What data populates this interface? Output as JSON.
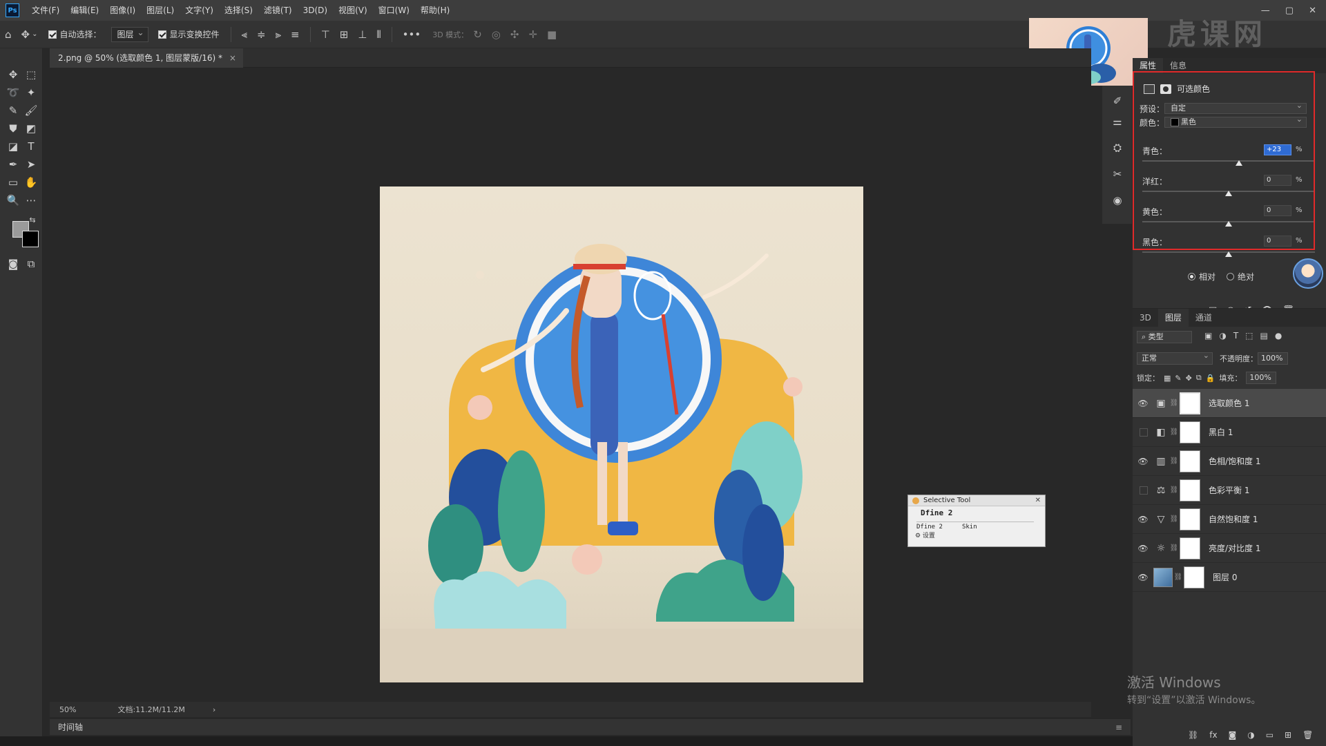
{
  "app": {
    "logo": "Ps"
  },
  "menu": [
    "文件(F)",
    "编辑(E)",
    "图像(I)",
    "图层(L)",
    "文字(Y)",
    "选择(S)",
    "滤镜(T)",
    "3D(D)",
    "视图(V)",
    "窗口(W)",
    "帮助(H)"
  ],
  "window_controls": {
    "minimize": "—",
    "restore": "▢",
    "close": "✕"
  },
  "options": {
    "auto_select_label": "自动选择：",
    "auto_select_target": "图层",
    "show_transform_label": "显示变换控件",
    "more": "•••",
    "mode_3d_label": "3D 模式："
  },
  "watermark": "虎课网",
  "document": {
    "tab_title": "2.png @ 50% (选取颜色 1, 图层蒙版/16) *",
    "tab_close": "×",
    "zoom": "50%",
    "doc_size": "文档:11.2M/11.2M",
    "arrow": "›"
  },
  "timeline_label": "时间轴",
  "filter_panel": {
    "title": "Selective Tool",
    "close": "✕",
    "name": "Dfine 2",
    "subs": [
      "Dfine 2",
      "Skin"
    ],
    "settings": "⚙ 设置"
  },
  "properties": {
    "tabs": [
      "属性",
      "信息"
    ],
    "title": "可选颜色",
    "preset_label": "预设：",
    "preset_value": "自定",
    "colors_label": "颜色：",
    "colors_value": "黑色",
    "sliders": [
      {
        "label": "青色：",
        "value": "+23",
        "pct": "%",
        "position": 0.56
      },
      {
        "label": "洋红：",
        "value": "0",
        "pct": "%",
        "position": 0.5
      },
      {
        "label": "黄色：",
        "value": "0",
        "pct": "%",
        "position": 0.5
      },
      {
        "label": "黑色：",
        "value": "0",
        "pct": "%",
        "position": 0.5
      }
    ],
    "method_relative": "相对",
    "method_absolute": "绝对"
  },
  "layers": {
    "tabs": [
      "3D",
      "图层",
      "通道"
    ],
    "filter_label": "类型",
    "blend_mode": "正常",
    "opacity_label": "不透明度：",
    "opacity_value": "100%",
    "lock_label": "锁定：",
    "fill_label": "填充：",
    "fill_value": "100%",
    "items": [
      {
        "name": "选取颜色 1",
        "icon": "selective-color-icon",
        "visible": true,
        "selected": true
      },
      {
        "name": "黑白 1",
        "icon": "black-white-icon",
        "visible": false,
        "selected": false
      },
      {
        "name": "色相/饱和度 1",
        "icon": "hue-saturation-icon",
        "visible": true,
        "selected": false
      },
      {
        "name": "色彩平衡 1",
        "icon": "color-balance-icon",
        "visible": false,
        "selected": false
      },
      {
        "name": "自然饱和度 1",
        "icon": "vibrance-icon",
        "visible": true,
        "selected": false
      },
      {
        "name": "亮度/对比度 1",
        "icon": "brightness-contrast-icon",
        "visible": true,
        "selected": false
      },
      {
        "name": "图层 0",
        "icon": "image-icon",
        "visible": true,
        "selected": false
      }
    ]
  },
  "os_watermark": {
    "title": "激活 Windows",
    "subtitle": "转到“设置”以激活 Windows。"
  },
  "colors": {
    "accent_red": "#e12a2a",
    "selection_blue": "#2f6bd3"
  }
}
